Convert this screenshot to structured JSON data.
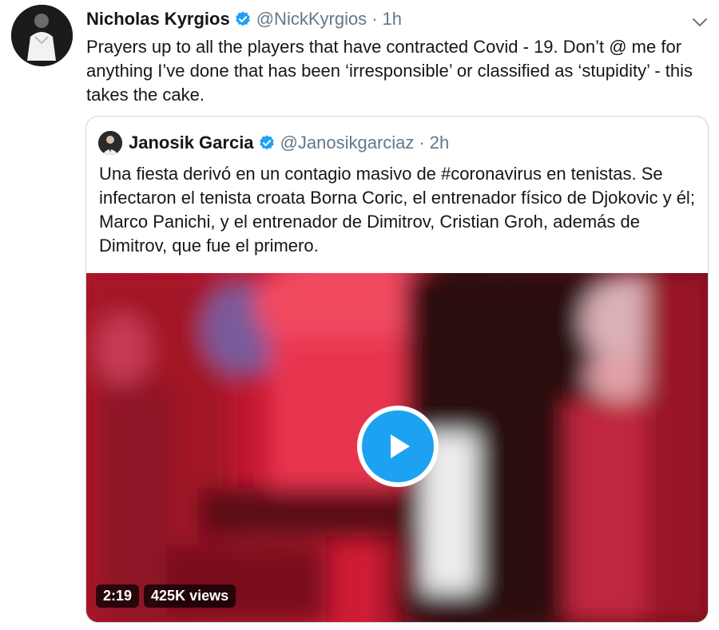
{
  "tweet": {
    "author_name": "Nicholas Kyrgios",
    "handle": "@NickKyrgios",
    "separator": "·",
    "time": "1h",
    "text": "Prayers up to all the players that have contracted Covid - 19. Don’t @ me for anything I’ve done that has been ‘irresponsible’ or classified as ‘stupidity’ - this takes the cake.",
    "icons": {
      "verified": "verified-badge-icon",
      "menu": "chevron-down-icon"
    }
  },
  "quoted": {
    "author_name": "Janosik Garcia",
    "handle": "@Janosikgarciaz",
    "separator": "·",
    "time": "2h",
    "text": "Una fiesta derivó en un contagio masivo de #coronavirus en tenistas. Se infectaron el tenista croata Borna Coric, el entrenador físico de Djokovic y él; Marco Panichi, y el entrenador de Dimitrov, Cristian Groh, además de Dimitrov, que fue el primero.",
    "video": {
      "duration": "2:19",
      "views": "425K views",
      "icon": "play-icon"
    }
  },
  "colors": {
    "accent": "#1da1f2",
    "text": "#14171a",
    "secondary_text": "#657786",
    "border": "#ccd6dd"
  }
}
